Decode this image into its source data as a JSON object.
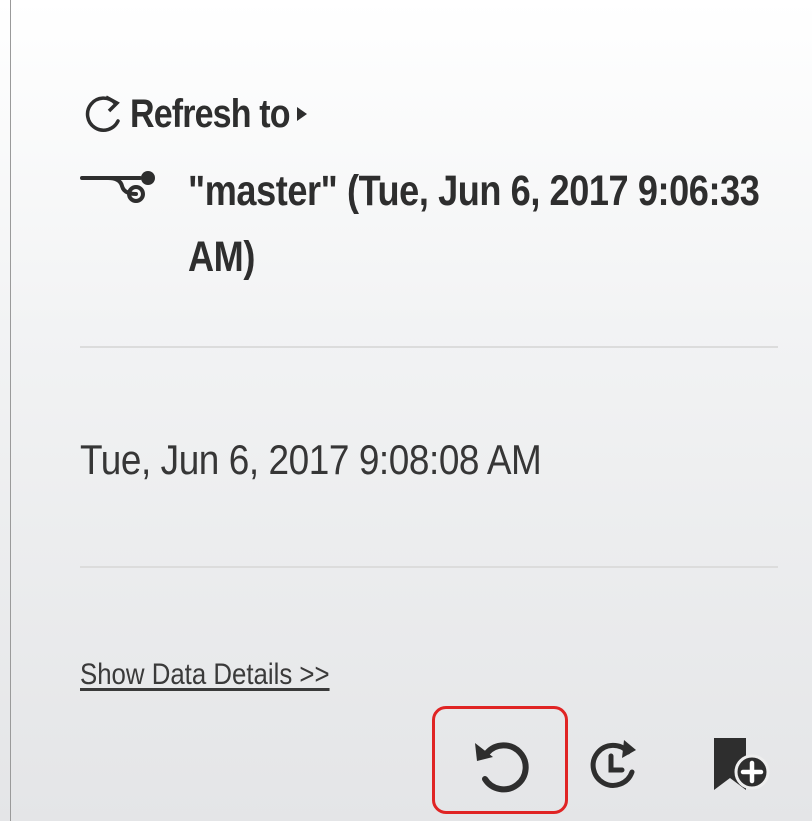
{
  "refresh": {
    "label": "Refresh to",
    "icon": "refresh-icon"
  },
  "branch": {
    "text": "\"master\" (Tue, Jun 6, 2017 9:06:33 AM)",
    "icon": "branch-icon"
  },
  "timestamp": "Tue, Jun 6, 2017 9:08:08 AM",
  "details_link": "Show Data Details >>",
  "toolbar": {
    "icons": [
      "undo-icon",
      "history-icon",
      "add-bookmark-icon"
    ],
    "highlight_color": "#e02424"
  }
}
